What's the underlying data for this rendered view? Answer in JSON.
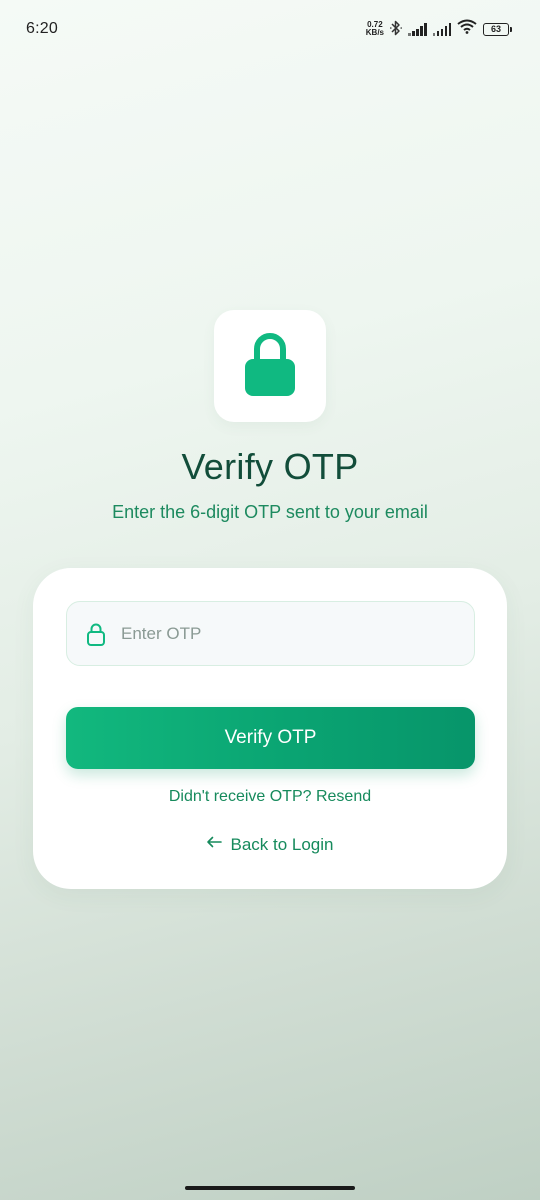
{
  "status_bar": {
    "time": "6:20",
    "net_speed_value": "0.72",
    "net_speed_unit": "KB/s",
    "battery": "63"
  },
  "header": {
    "icon": "lock-icon",
    "title": "Verify OTP",
    "subtitle": "Enter the 6-digit OTP sent to your email"
  },
  "form": {
    "otp_placeholder": "Enter OTP",
    "otp_value": "",
    "field_icon": "lock-outline-icon",
    "verify_label": "Verify OTP",
    "resend_text": "Didn't receive OTP? Resend",
    "back_icon": "arrow-left-icon",
    "back_text": "Back to Login"
  },
  "colors": {
    "accent": "#10b981",
    "accent_dark": "#07956a",
    "title": "#124d3a",
    "link": "#168a5c"
  }
}
